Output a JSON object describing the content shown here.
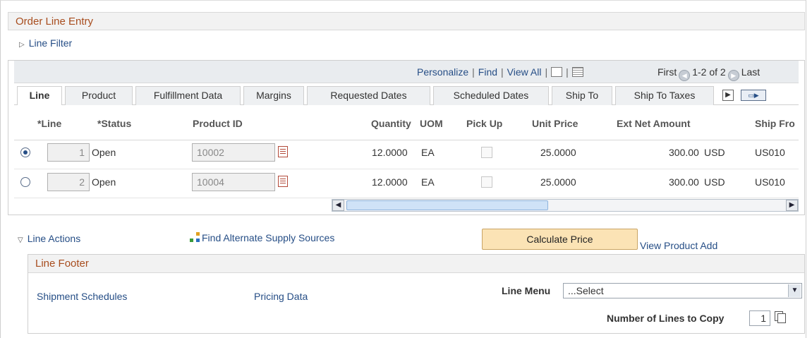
{
  "section_title": "Order Line Entry",
  "line_filter": "Line Filter",
  "grid_nav": {
    "personalize": "Personalize",
    "find": "Find",
    "view_all": "View All",
    "first": "First",
    "range": "1-2 of 2",
    "last": "Last"
  },
  "tabs": [
    "Line",
    "Product",
    "Fulfillment Data",
    "Margins",
    "Requested Dates",
    "Scheduled Dates",
    "Ship To",
    "Ship To Taxes"
  ],
  "columns": [
    "*Line",
    "*Status",
    "Product ID",
    "Quantity",
    "UOM",
    "Pick Up",
    "Unit Price",
    "Ext Net Amount",
    "Ship Fro"
  ],
  "rows": [
    {
      "selected": true,
      "line": "1",
      "status": "Open",
      "product_id": "10002",
      "quantity": "12.0000",
      "uom": "EA",
      "pick_up": false,
      "unit_price": "25.0000",
      "ext_net_amount": "300.00",
      "currency": "USD",
      "ship_from": "US010"
    },
    {
      "selected": false,
      "line": "2",
      "status": "Open",
      "product_id": "10004",
      "quantity": "12.0000",
      "uom": "EA",
      "pick_up": false,
      "unit_price": "25.0000",
      "ext_net_amount": "300.00",
      "currency": "USD",
      "ship_from": "US010"
    }
  ],
  "line_actions": "Line Actions",
  "find_alternate": "Find Alternate Supply Sources",
  "calculate_price": "Calculate Price",
  "view_product_add": "View Product Add",
  "footer": {
    "title": "Line Footer",
    "shipment_schedules": "Shipment Schedules",
    "pricing_data": "Pricing Data",
    "line_menu_label": "Line Menu",
    "line_menu_value": "...Select",
    "copy_label": "Number of Lines to Copy",
    "copy_value": "1"
  },
  "colors": {
    "link": "#264e86",
    "section_title": "#a84d1e",
    "button_bg": "#fbe3b5"
  },
  "icons": [
    "triangle-right-icon",
    "new-window-icon",
    "spreadsheet-icon",
    "previous-icon",
    "next-icon",
    "lookup-icon",
    "triangle-down-icon",
    "supply-sources-icon",
    "dropdown-arrow-icon",
    "copy-icon",
    "scroll-left-icon",
    "scroll-right-icon",
    "show-next-tab-icon",
    "show-all-tabs-icon"
  ]
}
